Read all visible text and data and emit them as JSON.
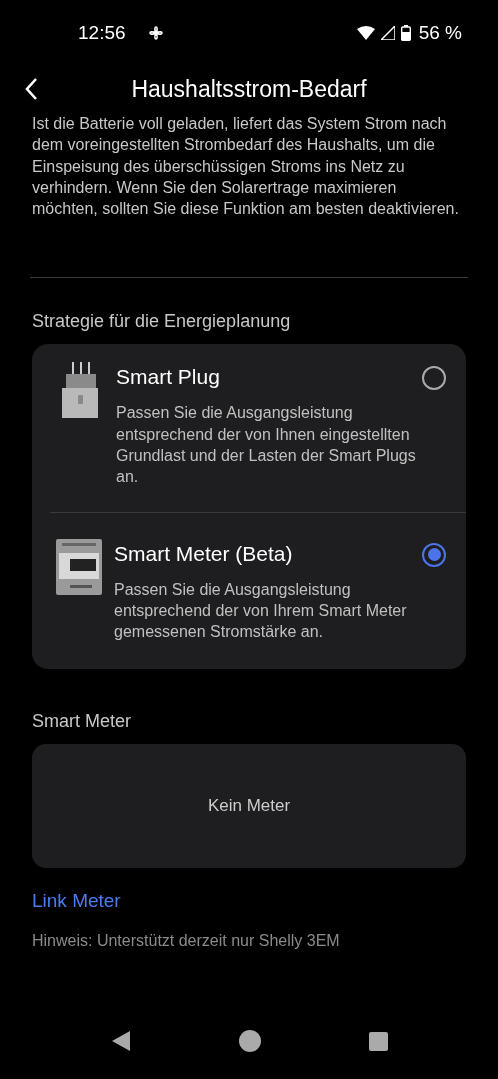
{
  "status_bar": {
    "time": "12:56",
    "battery": "56 %"
  },
  "header": {
    "title": "Haushaltsstrom-Bedarf"
  },
  "description": "Ist die Batterie voll geladen, liefert das System Strom nach dem voreingestellten Strombedarf des Haushalts, um die Einspeisung des überschüssigen Stroms ins Netz zu verhindern. Wenn Sie den Solarertrage maximieren möchten, sollten Sie diese Funktion am besten deaktivieren.",
  "strategy": {
    "label": "Strategie für die Energieplanung",
    "options": [
      {
        "kind": "plug",
        "title": "Smart Plug",
        "text": "Passen Sie die Ausgangsleistung entsprechend der von Ihnen eingestellten Grundlast und der Lasten der Smart Plugs an.",
        "selected": false
      },
      {
        "kind": "meter",
        "title": "Smart Meter (Beta)",
        "text": "Passen Sie die Ausgangsleistung entsprechend der von Ihrem Smart Meter gemessenen Stromstärke an.",
        "selected": true
      }
    ]
  },
  "smart_meter": {
    "label": "Smart Meter",
    "empty_text": "Kein Meter",
    "link": "Link Meter",
    "hint": "Hinweis: Unterstützt derzeit nur Shelly 3EM"
  }
}
